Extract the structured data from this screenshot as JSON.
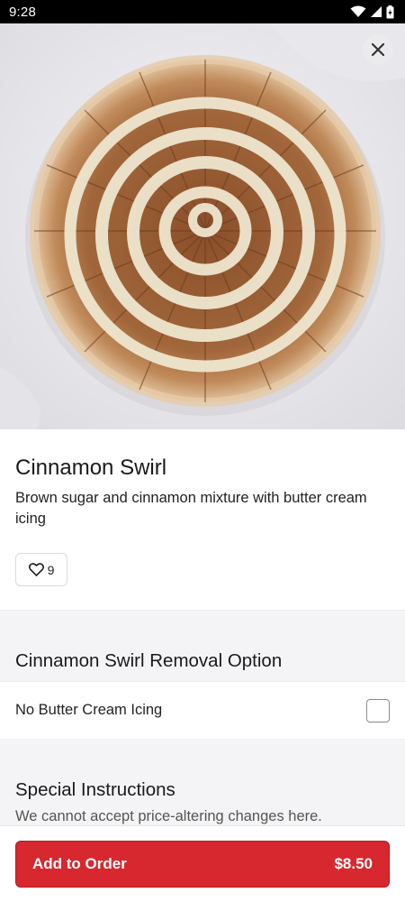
{
  "status_bar": {
    "time": "9:28",
    "icons": [
      "wifi-icon",
      "signal-icon",
      "battery-icon"
    ]
  },
  "item": {
    "title": "Cinnamon Swirl",
    "description": "Brown sugar and cinnamon mixture with butter cream icing",
    "likes": "9",
    "image": "cinnamon-swirl-pizza"
  },
  "removal_section": {
    "title": "Cinnamon Swirl Removal Option",
    "options": [
      {
        "label": "No Butter Cream Icing",
        "checked": false
      }
    ]
  },
  "special_instructions": {
    "title": "Special Instructions",
    "note": "We cannot accept price-altering changes here."
  },
  "add_to_order": {
    "label": "Add to Order",
    "price": "$8.50"
  },
  "colors": {
    "accent": "#d7272f",
    "section_bg": "#f4f4f6"
  }
}
